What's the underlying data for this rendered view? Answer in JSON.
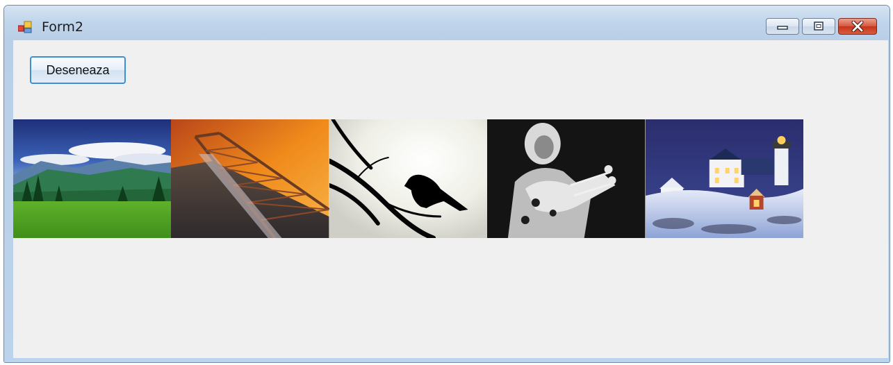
{
  "window": {
    "title": "Form2"
  },
  "caption_buttons": {
    "minimize_icon": "minimize-icon",
    "maximize_icon": "maximize-icon",
    "close_icon": "close-icon"
  },
  "toolbar": {
    "draw_label": "Deseneaza"
  },
  "images": [
    {
      "name": "mountain-landscape-image"
    },
    {
      "name": "bridge-sunset-image"
    },
    {
      "name": "bird-silhouette-image"
    },
    {
      "name": "guitarist-photo-image"
    },
    {
      "name": "lighthouse-snow-image"
    }
  ],
  "colors": {
    "title_bar": "#c0d5ea",
    "client_bg": "#f0f0f0",
    "button_focus_border": "#3c8fd0",
    "close_button": "#c5361d"
  }
}
